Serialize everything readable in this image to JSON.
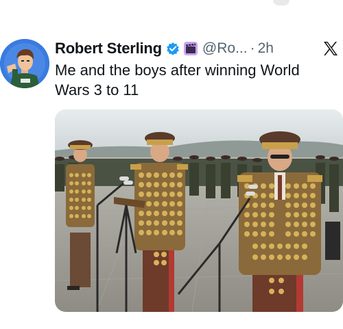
{
  "tweet": {
    "display_name": "Robert Sterling",
    "handle": "@Ro...",
    "separator": "·",
    "time": "2h",
    "text": "Me and the boys after winning World Wars 3 to 11"
  },
  "icons": {
    "verified": "verified-badge-icon",
    "affiliate": "clapperboard-affiliate-icon",
    "platform": "x-logo-icon"
  },
  "colors": {
    "verified_blue": "#1d9bf0",
    "affiliate_purple": "#a77de0",
    "handle_gray": "#536471",
    "uniform_khaki": "#7a5a3a",
    "medal_gold": "#d6b25a",
    "trouser_red": "#b23a32"
  }
}
